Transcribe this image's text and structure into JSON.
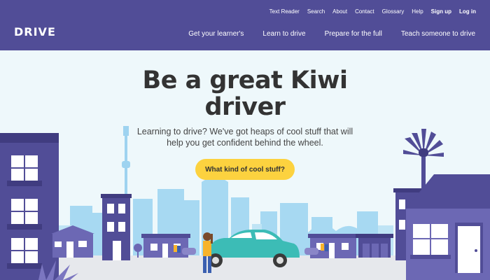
{
  "brand": {
    "logo": "DRIVE"
  },
  "util_nav": [
    "Text Reader",
    "Search",
    "About",
    "Contact",
    "Glossary",
    "Help",
    "Sign up",
    "Log in"
  ],
  "main_nav": [
    "Get your learner's",
    "Learn to drive",
    "Prepare for the full",
    "Teach someone to drive"
  ],
  "hero": {
    "title_line1": "Be a great Kiwi",
    "title_line2": "driver",
    "subtitle": "Learning to drive? We've got heaps of cool stuff that will help you get confident behind the wheel.",
    "cta": "What kind of cool stuff?"
  },
  "colors": {
    "header": "#514d97",
    "cta": "#fcd23f",
    "building": "#514d97",
    "car": "#3cbcb6",
    "skyline": "#8fcdef"
  }
}
